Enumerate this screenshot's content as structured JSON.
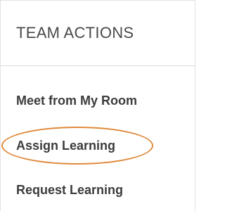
{
  "panel": {
    "title": "TEAM ACTIONS",
    "actions": [
      {
        "label": "Meet from My Room"
      },
      {
        "label": "Assign Learning",
        "highlighted": true
      },
      {
        "label": "Request Learning"
      }
    ]
  },
  "colors": {
    "highlight": "#e0893a",
    "text": "#3c3c3c",
    "title": "#4a4a4a",
    "divider": "#dcdcdc"
  }
}
